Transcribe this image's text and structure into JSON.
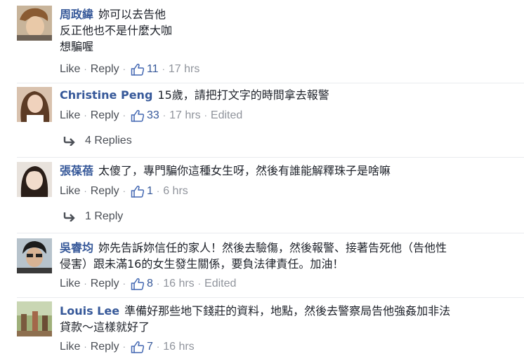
{
  "comments": [
    {
      "author": "周政緯",
      "lines": [
        "妳可以去告他",
        "反正他也不是什麼大咖",
        "想騙喔"
      ],
      "actions": {
        "like": "Like",
        "reply": "Reply",
        "likes": "11",
        "time": "17 hrs"
      }
    },
    {
      "author": "Christine Peng",
      "lines": [
        "15歲，請把打文字的時間拿去報警"
      ],
      "actions": {
        "like": "Like",
        "reply": "Reply",
        "likes": "33",
        "time": "17 hrs",
        "edited": "Edited"
      },
      "replies": "4 Replies"
    },
    {
      "author": "張葆蓓",
      "lines": [
        "太傻了，專門騙你這種女生呀，然後有誰能解釋珠子是啥嘛"
      ],
      "actions": {
        "like": "Like",
        "reply": "Reply",
        "likes": "1",
        "time": "6 hrs"
      },
      "replies": "1 Reply"
    },
    {
      "author": "吳睿均",
      "lines": [
        "妳先告訴妳信任的家人！然後去驗傷，然後報警、接著告死他（告他性",
        "侵害）跟未滿16的女生發生關係，要負法律責任。加油！"
      ],
      "actions": {
        "like": "Like",
        "reply": "Reply",
        "likes": "8",
        "time": "16 hrs",
        "edited": "Edited"
      }
    },
    {
      "author": "Louis Lee",
      "lines": [
        "準備好那些地下錢莊的資料，地點，然後去警察局告他強姦加非法",
        "貸款～這樣就好了"
      ],
      "actions": {
        "like": "Like",
        "reply": "Reply",
        "likes": "7",
        "time": "16 hrs"
      }
    }
  ],
  "icons": {
    "like": "thumbs-up-icon",
    "reply_arrow": "reply-arrow-icon"
  },
  "colors": {
    "name": "#365899",
    "text": "#1d2129",
    "muted": "#90949c",
    "action": "#4b4f56"
  }
}
